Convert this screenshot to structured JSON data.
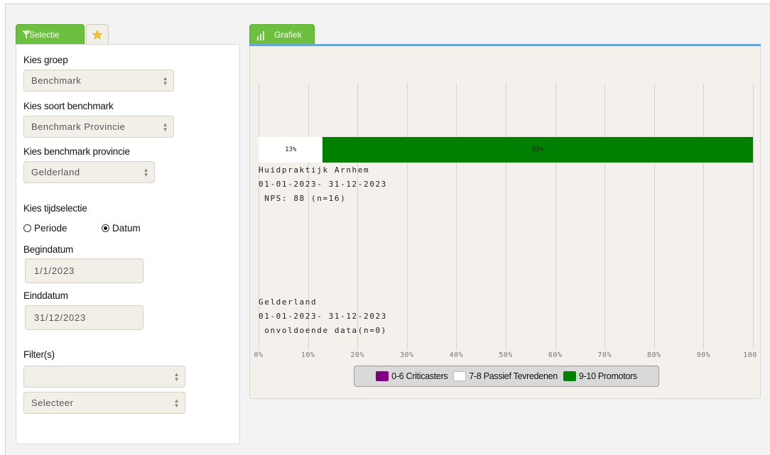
{
  "selection_panel": {
    "tab_label": "Selectie",
    "group_label": "Kies groep",
    "group_value": "Benchmark",
    "benchmark_type_label": "Kies soort benchmark",
    "benchmark_type_value": "Benchmark Provincie",
    "province_label": "Kies benchmark provincie",
    "province_value": "Gelderland",
    "time_label": "Kies tijdselectie",
    "radio_period": "Periode",
    "radio_date": "Datum",
    "selected_radio": "Datum",
    "start_label": "Begindatum",
    "start_value": "1/1/2023",
    "end_label": "Einddatum",
    "end_value": "31/12/2023",
    "filter_label": "Filter(s)",
    "filter_value": "",
    "filter2_value": "Selecteer"
  },
  "chart_tab": {
    "label": "Grafiek"
  },
  "chart_data": {
    "type": "bar",
    "orientation": "horizontal",
    "stacked": true,
    "xlim": [
      0,
      100
    ],
    "x_ticks": [
      "0%",
      "10%",
      "20%",
      "30%",
      "40%",
      "50%",
      "60%",
      "70%",
      "80%",
      "90%",
      "100"
    ],
    "grid": true,
    "rows": [
      {
        "lines": [
          "Huidpraktijk Arnhem",
          "01-01-2023- 31-12-2023",
          " NPS: 88 (n=16)"
        ],
        "segments": [
          {
            "series": "0-6 Criticasters",
            "value": 0,
            "label": ""
          },
          {
            "series": "7-8 Passief Tevredenen",
            "value": 13,
            "label": "13%"
          },
          {
            "series": "9-10 Promotors",
            "value": 88,
            "label": "88%"
          }
        ]
      },
      {
        "lines": [
          "Gelderland",
          "01-01-2023- 31-12-2023",
          " onvoldoende data(n=0)"
        ],
        "segments": []
      }
    ],
    "legend": [
      {
        "name": "0-6 Criticasters",
        "color": "#800080"
      },
      {
        "name": "7-8 Passief Tevredenen",
        "color": "#ffffff"
      },
      {
        "name": "9-10 Promotors",
        "color": "#008000"
      }
    ],
    "legend_position": "bottom"
  }
}
